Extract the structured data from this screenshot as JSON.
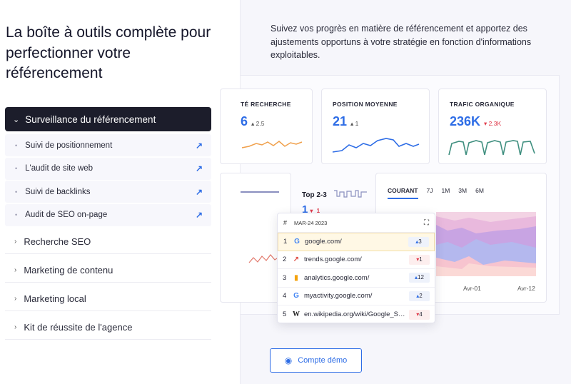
{
  "headline": "La boîte à outils complète pour perfectionner votre référencement",
  "accordion": {
    "active": {
      "label": "Surveillance du référencement",
      "chevron": "chevron-down-icon"
    },
    "subitems": [
      {
        "label": "Suivi de positionnement"
      },
      {
        "label": "L'audit de site web"
      },
      {
        "label": "Suivi de backlinks"
      },
      {
        "label": "Audit de SEO on-page"
      }
    ],
    "collapsed": [
      {
        "label": "Recherche SEO"
      },
      {
        "label": "Marketing de contenu"
      },
      {
        "label": "Marketing local"
      },
      {
        "label": "Kit de réussite de l'agence"
      }
    ]
  },
  "description": "Suivez vos progrès en matière de référencement et apportez des ajustements opportuns à votre stratégie en fonction d'informations exploitables.",
  "metrics": [
    {
      "title": "TÉ RECHERCHE",
      "value": "6",
      "delta": "2.5",
      "direction": "up",
      "color": "#f0a04b"
    },
    {
      "title": "POSITION MOYENNE",
      "value": "21",
      "delta": "1",
      "direction": "up",
      "color": "#2e6de6"
    },
    {
      "title": "TRAFIC ORGANIQUE",
      "value": "236K",
      "delta": "2.3K",
      "direction": "down",
      "color": "#3f8f7f"
    }
  ],
  "top23": {
    "title": "Top 2-3",
    "value": "1",
    "delta": "1"
  },
  "chart_tabs": [
    "COURANT",
    "7J",
    "1M",
    "3M",
    "6M"
  ],
  "chart_xlabels": [
    "Avr-01",
    "Avr-12"
  ],
  "table": {
    "header": "MAR-24 2023",
    "rows": [
      {
        "rank": "1",
        "icon": "google-icon",
        "favicon_char": "G",
        "url": "google.com/",
        "change": "3",
        "direction": "up"
      },
      {
        "rank": "2",
        "icon": "trend-icon",
        "favicon_char": "↗",
        "url": "trends.google.com/",
        "change": "1",
        "direction": "down"
      },
      {
        "rank": "3",
        "icon": "analytics-icon",
        "favicon_char": "▮",
        "url": "analytics.google.com/",
        "change": "12",
        "direction": "up"
      },
      {
        "rank": "4",
        "icon": "google-icon",
        "favicon_char": "G",
        "url": "myactivity.google.com/",
        "change": "2",
        "direction": "up"
      },
      {
        "rank": "5",
        "icon": "wikipedia-icon",
        "favicon_char": "W",
        "url": "en.wikipedia.org/wiki/Google_Se...",
        "change": "4",
        "direction": "down"
      }
    ]
  },
  "demo_button": "Compte démo",
  "colors": {
    "accent": "#2e6de6",
    "dark": "#1c1d2b",
    "negative": "#e03b4b"
  }
}
